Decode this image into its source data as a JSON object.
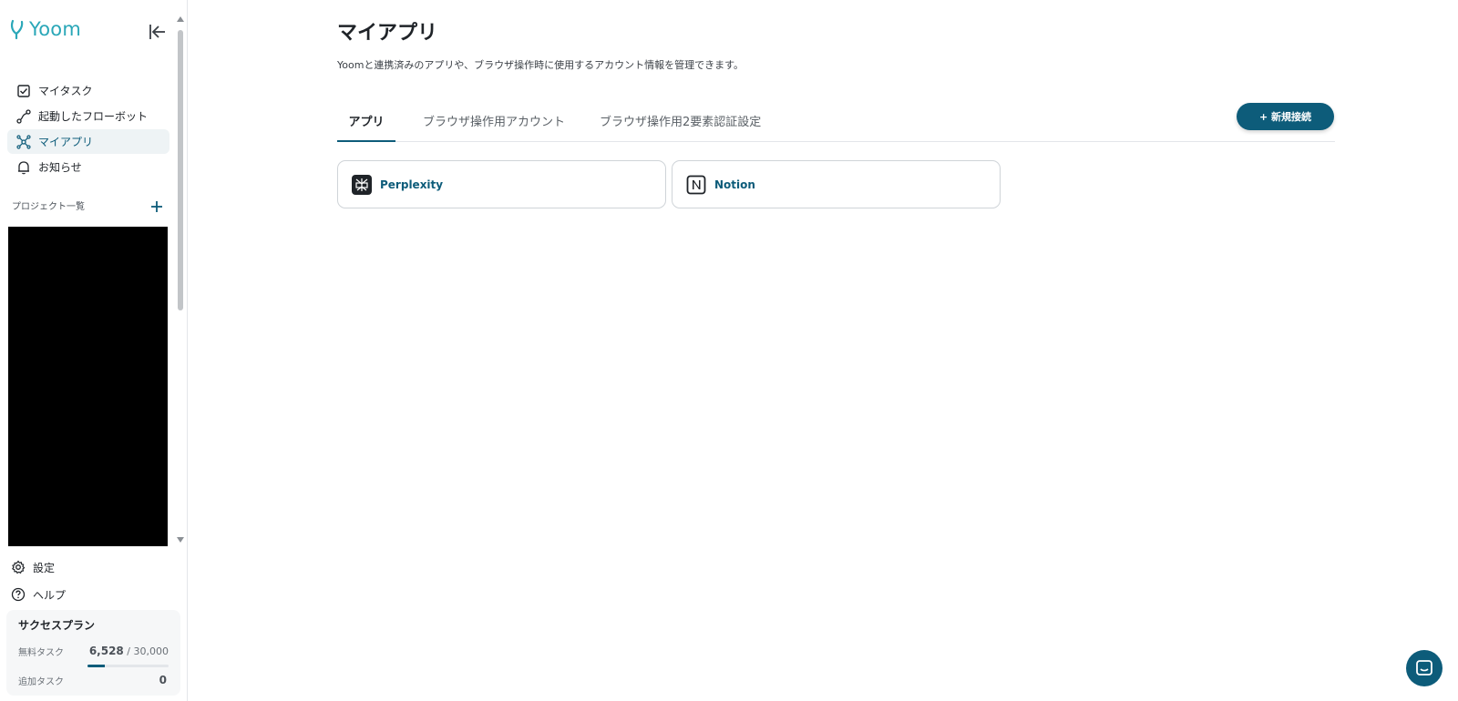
{
  "brand": {
    "name": "Yoom",
    "accent": "#2aa7b8",
    "primary": "#0d5c7a"
  },
  "sidebar": {
    "nav": [
      {
        "label": "マイタスク",
        "icon": "checkbox-icon"
      },
      {
        "label": "起動したフローボット",
        "icon": "flow-icon"
      },
      {
        "label": "マイアプリ",
        "icon": "apps-network-icon",
        "active": true
      },
      {
        "label": "お知らせ",
        "icon": "bell-icon"
      }
    ],
    "projects_label": "プロジェクト一覧",
    "bottom": [
      {
        "label": "設定",
        "icon": "gear-icon"
      },
      {
        "label": "ヘルプ",
        "icon": "help-circle-icon"
      }
    ],
    "plan": {
      "title": "サクセスプラン",
      "free_label": "無料タスク",
      "free_used": "6,528",
      "free_total": "/ 30,000",
      "free_progress": 0.218,
      "extra_label": "追加タスク",
      "extra_value": "0"
    }
  },
  "main": {
    "title": "マイアプリ",
    "description": "Yoomと連携済みのアプリや、ブラウザ操作時に使用するアカウント情報を管理できます。",
    "tabs": [
      {
        "label": "アプリ",
        "active": true
      },
      {
        "label": "ブラウザ操作用アカウント"
      },
      {
        "label": "ブラウザ操作用2要素認証設定"
      }
    ],
    "new_button": "+ 新規接続",
    "apps": [
      {
        "name": "Perplexity",
        "icon": "perplexity-icon"
      },
      {
        "name": "Notion",
        "icon": "notion-icon"
      }
    ]
  }
}
